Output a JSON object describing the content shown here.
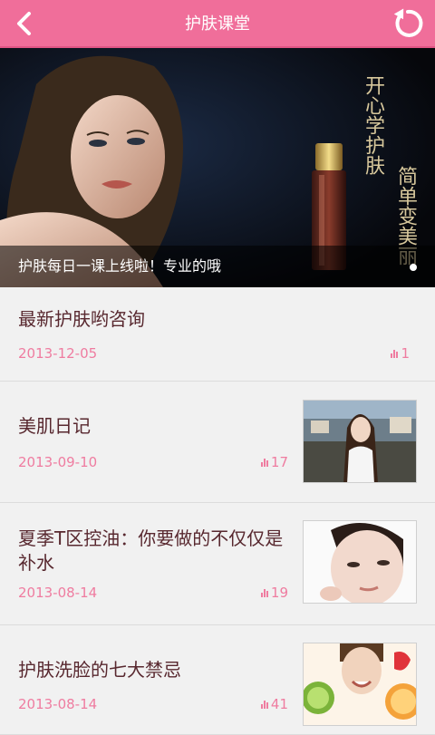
{
  "header": {
    "title": "护肤课堂",
    "back_icon": "back-arrow-icon",
    "refresh_icon": "refresh-icon",
    "bg_color": "#f06e9a"
  },
  "banner": {
    "caption": "护肤每日一课上线啦！专业的哦",
    "calligraphy_1": "开心学护肤",
    "calligraphy_2": "简单变美丽",
    "slide_count_visible": 1
  },
  "articles": [
    {
      "title": "最新护肤哟咨询",
      "date": "2013-12-05",
      "count": "1",
      "has_thumb": false
    },
    {
      "title": "美肌日记",
      "date": "2013-09-10",
      "count": "17",
      "has_thumb": true
    },
    {
      "title": "夏季T区控油：你要做的不仅仅是补水",
      "date": "2013-08-14",
      "count": "19",
      "has_thumb": true
    },
    {
      "title": "护肤洗脸的七大禁忌",
      "date": "2013-08-14",
      "count": "41",
      "has_thumb": true
    }
  ],
  "colors": {
    "title_text": "#58282f",
    "meta_text": "#ef7ca0",
    "background": "#f1f1f1"
  }
}
